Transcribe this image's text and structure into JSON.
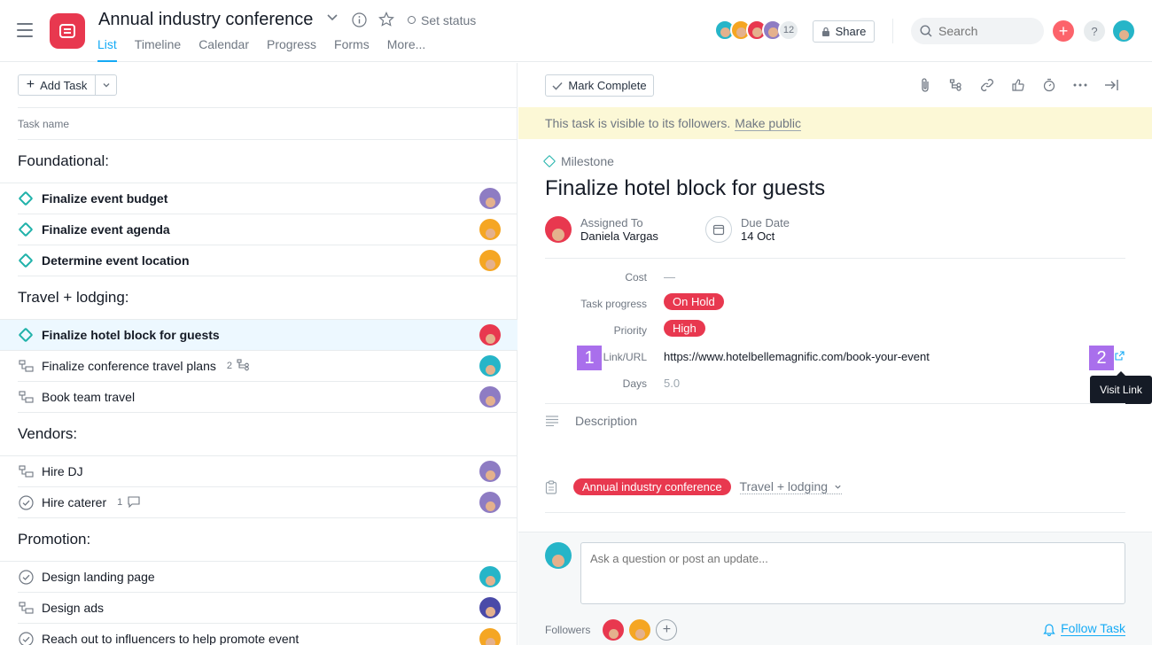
{
  "header": {
    "project_title": "Annual industry conference",
    "set_status": "Set status",
    "tabs": [
      {
        "label": "List",
        "active": true
      },
      {
        "label": "Timeline"
      },
      {
        "label": "Calendar"
      },
      {
        "label": "Progress"
      },
      {
        "label": "Forms"
      },
      {
        "label": "More..."
      }
    ],
    "member_count": "12",
    "member_colors": [
      "#26b5c8",
      "#f5a623",
      "#e8384f",
      "#8e7cc3"
    ],
    "share_label": "Share",
    "search_placeholder": "Search",
    "plus_icon": "plus-icon",
    "help_label": "?",
    "accent": "#14aaf5",
    "brand_red": "#e8384f"
  },
  "left": {
    "add_task_label": "Add Task",
    "column_header": "Task name",
    "sections": [
      {
        "title": "Foundational:",
        "tasks": [
          {
            "name": "Finalize event budget",
            "type": "milestone",
            "avatar_color": "#8e7cc3"
          },
          {
            "name": "Finalize event agenda",
            "type": "milestone",
            "avatar_color": "#f5a623"
          },
          {
            "name": "Determine event location",
            "type": "milestone",
            "avatar_color": "#f5a623"
          }
        ]
      },
      {
        "title": "Travel + lodging:",
        "tasks": [
          {
            "name": "Finalize hotel block for guests",
            "type": "milestone",
            "avatar_color": "#e8384f",
            "selected": true
          },
          {
            "name": "Finalize conference travel plans",
            "type": "subtask",
            "avatar_color": "#26b5c8",
            "meta": "2",
            "meta_icon": "subtask-icon"
          },
          {
            "name": "Book team travel",
            "type": "subtask",
            "avatar_color": "#8e7cc3"
          }
        ]
      },
      {
        "title": "Vendors:",
        "tasks": [
          {
            "name": "Hire DJ",
            "type": "subtask",
            "avatar_color": "#8e7cc3"
          },
          {
            "name": "Hire caterer",
            "type": "check",
            "avatar_color": "#8e7cc3",
            "meta": "1",
            "meta_icon": "comment-icon"
          }
        ]
      },
      {
        "title": "Promotion:",
        "tasks": [
          {
            "name": "Design landing page",
            "type": "check",
            "avatar_color": "#26b5c8"
          },
          {
            "name": "Design ads",
            "type": "subtask",
            "avatar_color": "#4a4aa8"
          },
          {
            "name": "Reach out to influencers to help promote event",
            "type": "check",
            "avatar_color": "#f5a623"
          }
        ]
      }
    ]
  },
  "detail": {
    "mark_complete_label": "Mark Complete",
    "visibility_text": "This task is visible to its followers.",
    "make_public_label": "Make public",
    "type_label": "Milestone",
    "title": "Finalize hotel block for guests",
    "assigned_to_label": "Assigned To",
    "assignee": "Daniela Vargas",
    "due_date_label": "Due Date",
    "due_date": "14 Oct",
    "fields": {
      "cost_label": "Cost",
      "cost_value": "—",
      "progress_label": "Task progress",
      "progress_value": "On Hold",
      "priority_label": "Priority",
      "priority_value": "High",
      "link_label": "Link/URL",
      "link_value": "https://www.hotelbellemagnific.com/book-your-event",
      "days_label": "Days",
      "days_value": "5.0"
    },
    "badge_1": "1",
    "badge_2": "2",
    "visit_link_tooltip": "Visit Link",
    "description_placeholder": "Description",
    "project_pill": "Annual industry conference",
    "section_select": "Travel + lodging",
    "comment_placeholder": "Ask a question or post an update...",
    "followers_label": "Followers",
    "follower_colors": [
      "#e8384f",
      "#f5a623"
    ],
    "follow_task_label": "Follow Task"
  }
}
